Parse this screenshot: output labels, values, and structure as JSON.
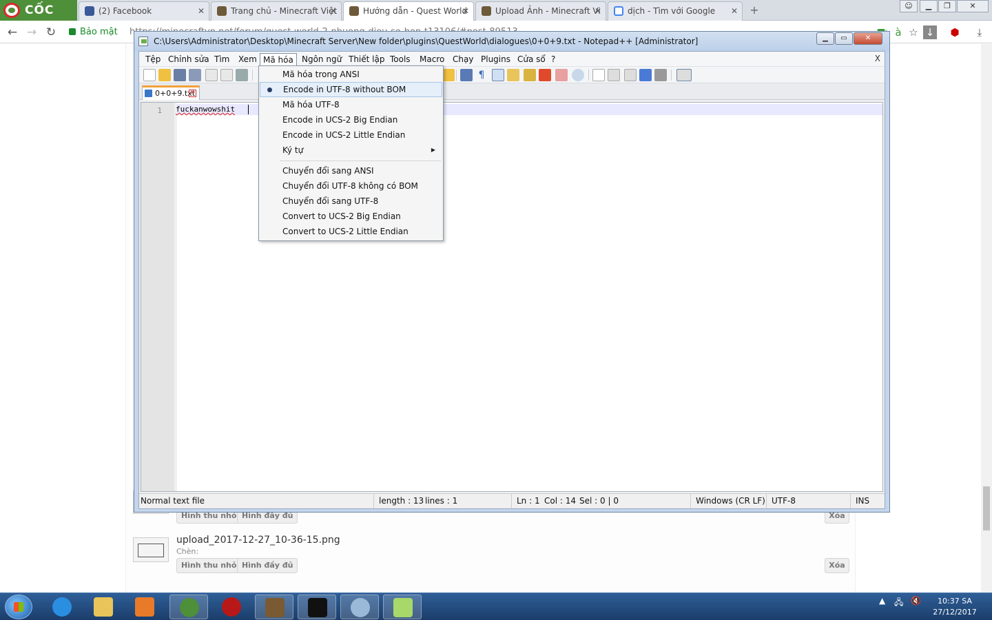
{
  "browser": {
    "logo": "CỐC CỐC",
    "tabs": [
      {
        "title": "(2) Facebook",
        "active": false
      },
      {
        "title": "Trang chủ - Minecraft Việt",
        "active": false
      },
      {
        "title": "Hướng dẫn - Quest World",
        "active": true
      },
      {
        "title": "Upload Ảnh - Minecraft Vi",
        "active": false
      },
      {
        "title": "dịch - Tìm với Google",
        "active": false
      }
    ],
    "new_tab_label": "+",
    "secure_label": "Bảo mật",
    "url": "https://minecraftvn.net/forum/quest-world-2-phuong-dieu-so-bon-t13106/#post-89513"
  },
  "page": {
    "uploads": [
      {
        "filename": "",
        "insert_label": "",
        "thumb_btn": "Hình thu nhỏ",
        "full_btn": "Hình đầy đủ",
        "delete_btn": "Xóa"
      },
      {
        "filename": "upload_2017-12-27_10-36-15.png",
        "insert_label": "Chèn:",
        "thumb_btn": "Hình thu nhỏ",
        "full_btn": "Hình đầy đủ",
        "delete_btn": "Xóa"
      }
    ]
  },
  "npp": {
    "title": "C:\\Users\\Administrator\\Desktop\\Minecraft Server\\New folder\\plugins\\QuestWorld\\dialogues\\0+0+9.txt - Notepad++ [Administrator]",
    "menu": [
      "Tệp",
      "Chỉnh sửa",
      "Tìm",
      "Xem",
      "Mã hóa",
      "Ngôn ngữ",
      "Thiết lập",
      "Tools",
      "Macro",
      "Chạy",
      "Plugins",
      "Cửa sổ",
      "?"
    ],
    "menu_close": "X",
    "file_tab": "0+0+9.txt",
    "line_number": "1",
    "code_line": "fuckanwowshit",
    "status": {
      "type": "Normal text file",
      "length": "length : 13",
      "lines": "lines : 1",
      "ln": "Ln : 1",
      "col": "Col : 14",
      "sel": "Sel : 0 | 0",
      "eol": "Windows (CR LF)",
      "encoding": "UTF-8",
      "mode": "INS"
    }
  },
  "encoding_menu": {
    "items": [
      {
        "label": "Mã hóa trong ANSI",
        "checked": false,
        "highlight": false
      },
      {
        "label": "Encode in UTF-8 without BOM",
        "checked": true,
        "highlight": true
      },
      {
        "label": "Mã hóa UTF-8",
        "checked": false,
        "highlight": false
      },
      {
        "label": "Encode in UCS-2 Big Endian",
        "checked": false,
        "highlight": false
      },
      {
        "label": "Encode in UCS-2 Little Endian",
        "checked": false,
        "highlight": false
      },
      {
        "label": "Ký tự",
        "checked": false,
        "highlight": false,
        "submenu": true
      }
    ],
    "convert_items": [
      {
        "label": "Chuyển đổi sang ANSI"
      },
      {
        "label": "Chuyển đổi UTF-8 không có BOM"
      },
      {
        "label": "Chuyển đổi sang UTF-8"
      },
      {
        "label": "Convert to UCS-2 Big Endian"
      },
      {
        "label": "Convert to UCS-2 Little Endian"
      }
    ]
  },
  "taskbar": {
    "clock_time": "10:37 SA",
    "clock_date": "27/12/2017"
  },
  "colors": {
    "coccoc_green": "#4e8f3a",
    "npp_frame": "#c5d6ec",
    "menu_highlight": "#e5effa",
    "taskbar": "#1b3d6a"
  }
}
